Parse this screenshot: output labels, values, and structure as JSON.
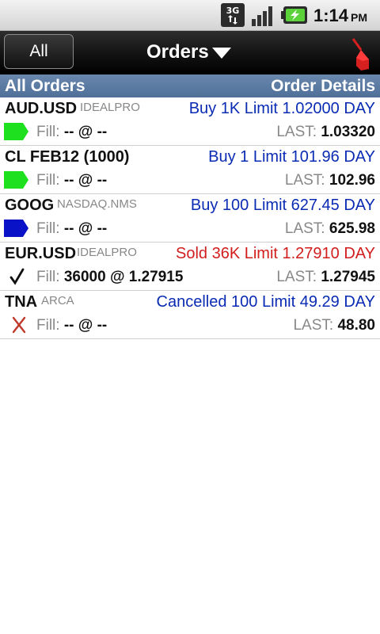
{
  "status_bar": {
    "network": "3G",
    "time": "1:14",
    "ampm": "PM"
  },
  "title_bar": {
    "all_button": "All",
    "title": "Orders"
  },
  "header": {
    "left": "All Orders",
    "right": "Order Details"
  },
  "colors": {
    "buy": "#0a2bb3",
    "sold": "#d21d1d",
    "header": "#5a7aa3",
    "green_status": "#1ee01e",
    "blue_status": "#0a12c8",
    "cancel_x": "#c0392b"
  },
  "orders": [
    {
      "symbol": "AUD.USD",
      "exchange": "IDEALPRO",
      "detail": "Buy 1K Limit 1.02000 DAY",
      "detail_color": "#0a2bb3",
      "status_icon": "green-tag-icon",
      "fill_label": "Fill:",
      "fill_value": "-- @ --",
      "last_label": "LAST:",
      "last_value": "1.03320"
    },
    {
      "symbol": "CL FEB12 (1000)",
      "exchange": "",
      "detail": "Buy 1 Limit 101.96 DAY",
      "detail_color": "#0a2bb3",
      "status_icon": "green-tag-icon",
      "fill_label": "Fill:",
      "fill_value": "-- @ --",
      "last_label": "LAST:",
      "last_value": "102.96"
    },
    {
      "symbol": "GOOG",
      "exchange": "NASDAQ.NMS",
      "detail": "Buy 100 Limit 627.45 DAY",
      "detail_color": "#0a2bb3",
      "status_icon": "blue-tag-icon",
      "fill_label": "Fill:",
      "fill_value": "-- @ --",
      "last_label": "LAST:",
      "last_value": "625.98"
    },
    {
      "symbol": "EUR.USD",
      "exchange": "IDEALPRO",
      "detail": "Sold 36K Limit 1.27910 DAY",
      "detail_color": "#d21d1d",
      "status_icon": "checkmark-icon",
      "fill_label": "Fill:",
      "fill_value": "36000 @ 1.27915",
      "last_label": "LAST:",
      "last_value": "1.27945"
    },
    {
      "symbol": "TNA",
      "exchange": "ARCA",
      "detail": "Cancelled 100 Limit 49.29 DAY",
      "detail_color": "#0a2bb3",
      "status_icon": "cancelled-x-icon",
      "fill_label": "Fill:",
      "fill_value": "-- @ --",
      "last_label": "LAST:",
      "last_value": "48.80"
    }
  ]
}
